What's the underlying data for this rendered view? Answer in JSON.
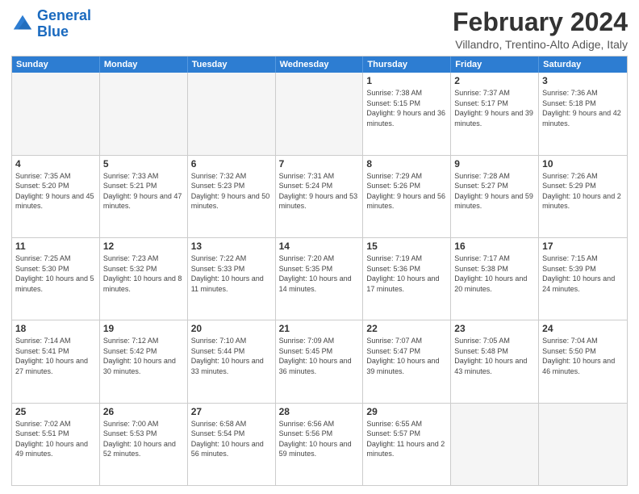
{
  "logo": {
    "text1": "General",
    "text2": "Blue"
  },
  "title": "February 2024",
  "location": "Villandro, Trentino-Alto Adige, Italy",
  "header": {
    "days": [
      "Sunday",
      "Monday",
      "Tuesday",
      "Wednesday",
      "Thursday",
      "Friday",
      "Saturday"
    ]
  },
  "rows": [
    {
      "cells": [
        {
          "day": "",
          "empty": true
        },
        {
          "day": "",
          "empty": true
        },
        {
          "day": "",
          "empty": true
        },
        {
          "day": "",
          "empty": true
        },
        {
          "day": "1",
          "sunrise": "Sunrise: 7:38 AM",
          "sunset": "Sunset: 5:15 PM",
          "daylight": "Daylight: 9 hours and 36 minutes."
        },
        {
          "day": "2",
          "sunrise": "Sunrise: 7:37 AM",
          "sunset": "Sunset: 5:17 PM",
          "daylight": "Daylight: 9 hours and 39 minutes."
        },
        {
          "day": "3",
          "sunrise": "Sunrise: 7:36 AM",
          "sunset": "Sunset: 5:18 PM",
          "daylight": "Daylight: 9 hours and 42 minutes."
        }
      ]
    },
    {
      "cells": [
        {
          "day": "4",
          "sunrise": "Sunrise: 7:35 AM",
          "sunset": "Sunset: 5:20 PM",
          "daylight": "Daylight: 9 hours and 45 minutes."
        },
        {
          "day": "5",
          "sunrise": "Sunrise: 7:33 AM",
          "sunset": "Sunset: 5:21 PM",
          "daylight": "Daylight: 9 hours and 47 minutes."
        },
        {
          "day": "6",
          "sunrise": "Sunrise: 7:32 AM",
          "sunset": "Sunset: 5:23 PM",
          "daylight": "Daylight: 9 hours and 50 minutes."
        },
        {
          "day": "7",
          "sunrise": "Sunrise: 7:31 AM",
          "sunset": "Sunset: 5:24 PM",
          "daylight": "Daylight: 9 hours and 53 minutes."
        },
        {
          "day": "8",
          "sunrise": "Sunrise: 7:29 AM",
          "sunset": "Sunset: 5:26 PM",
          "daylight": "Daylight: 9 hours and 56 minutes."
        },
        {
          "day": "9",
          "sunrise": "Sunrise: 7:28 AM",
          "sunset": "Sunset: 5:27 PM",
          "daylight": "Daylight: 9 hours and 59 minutes."
        },
        {
          "day": "10",
          "sunrise": "Sunrise: 7:26 AM",
          "sunset": "Sunset: 5:29 PM",
          "daylight": "Daylight: 10 hours and 2 minutes."
        }
      ]
    },
    {
      "cells": [
        {
          "day": "11",
          "sunrise": "Sunrise: 7:25 AM",
          "sunset": "Sunset: 5:30 PM",
          "daylight": "Daylight: 10 hours and 5 minutes."
        },
        {
          "day": "12",
          "sunrise": "Sunrise: 7:23 AM",
          "sunset": "Sunset: 5:32 PM",
          "daylight": "Daylight: 10 hours and 8 minutes."
        },
        {
          "day": "13",
          "sunrise": "Sunrise: 7:22 AM",
          "sunset": "Sunset: 5:33 PM",
          "daylight": "Daylight: 10 hours and 11 minutes."
        },
        {
          "day": "14",
          "sunrise": "Sunrise: 7:20 AM",
          "sunset": "Sunset: 5:35 PM",
          "daylight": "Daylight: 10 hours and 14 minutes."
        },
        {
          "day": "15",
          "sunrise": "Sunrise: 7:19 AM",
          "sunset": "Sunset: 5:36 PM",
          "daylight": "Daylight: 10 hours and 17 minutes."
        },
        {
          "day": "16",
          "sunrise": "Sunrise: 7:17 AM",
          "sunset": "Sunset: 5:38 PM",
          "daylight": "Daylight: 10 hours and 20 minutes."
        },
        {
          "day": "17",
          "sunrise": "Sunrise: 7:15 AM",
          "sunset": "Sunset: 5:39 PM",
          "daylight": "Daylight: 10 hours and 24 minutes."
        }
      ]
    },
    {
      "cells": [
        {
          "day": "18",
          "sunrise": "Sunrise: 7:14 AM",
          "sunset": "Sunset: 5:41 PM",
          "daylight": "Daylight: 10 hours and 27 minutes."
        },
        {
          "day": "19",
          "sunrise": "Sunrise: 7:12 AM",
          "sunset": "Sunset: 5:42 PM",
          "daylight": "Daylight: 10 hours and 30 minutes."
        },
        {
          "day": "20",
          "sunrise": "Sunrise: 7:10 AM",
          "sunset": "Sunset: 5:44 PM",
          "daylight": "Daylight: 10 hours and 33 minutes."
        },
        {
          "day": "21",
          "sunrise": "Sunrise: 7:09 AM",
          "sunset": "Sunset: 5:45 PM",
          "daylight": "Daylight: 10 hours and 36 minutes."
        },
        {
          "day": "22",
          "sunrise": "Sunrise: 7:07 AM",
          "sunset": "Sunset: 5:47 PM",
          "daylight": "Daylight: 10 hours and 39 minutes."
        },
        {
          "day": "23",
          "sunrise": "Sunrise: 7:05 AM",
          "sunset": "Sunset: 5:48 PM",
          "daylight": "Daylight: 10 hours and 43 minutes."
        },
        {
          "day": "24",
          "sunrise": "Sunrise: 7:04 AM",
          "sunset": "Sunset: 5:50 PM",
          "daylight": "Daylight: 10 hours and 46 minutes."
        }
      ]
    },
    {
      "cells": [
        {
          "day": "25",
          "sunrise": "Sunrise: 7:02 AM",
          "sunset": "Sunset: 5:51 PM",
          "daylight": "Daylight: 10 hours and 49 minutes."
        },
        {
          "day": "26",
          "sunrise": "Sunrise: 7:00 AM",
          "sunset": "Sunset: 5:53 PM",
          "daylight": "Daylight: 10 hours and 52 minutes."
        },
        {
          "day": "27",
          "sunrise": "Sunrise: 6:58 AM",
          "sunset": "Sunset: 5:54 PM",
          "daylight": "Daylight: 10 hours and 56 minutes."
        },
        {
          "day": "28",
          "sunrise": "Sunrise: 6:56 AM",
          "sunset": "Sunset: 5:56 PM",
          "daylight": "Daylight: 10 hours and 59 minutes."
        },
        {
          "day": "29",
          "sunrise": "Sunrise: 6:55 AM",
          "sunset": "Sunset: 5:57 PM",
          "daylight": "Daylight: 11 hours and 2 minutes."
        },
        {
          "day": "",
          "empty": true
        },
        {
          "day": "",
          "empty": true
        }
      ]
    }
  ]
}
